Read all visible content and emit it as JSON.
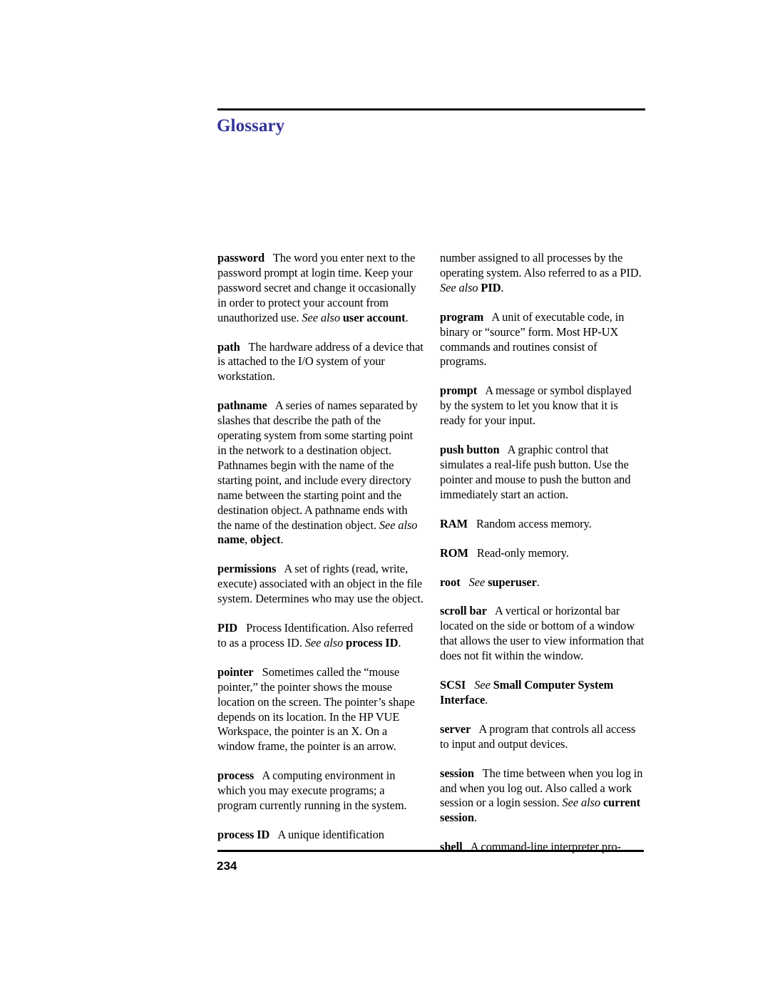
{
  "document": {
    "title": "Glossary",
    "title_color": "#333399",
    "page_number": "234"
  },
  "columns": {
    "left": [
      {
        "term": "password",
        "body_1": "The word you enter next to the password prompt at login time. Keep your password secret and change it occasionally in order to protect your account from unauthorized use. ",
        "see_also": "See also",
        "ref": " user account",
        "tail": "."
      },
      {
        "term": "path",
        "body_1": "The hardware address of a device that is attached to the I/O system of your workstation.",
        "see_also": "",
        "ref": "",
        "tail": ""
      },
      {
        "term": "pathname",
        "body_1": "A series of names separated by slashes that describe the path of the operating system from some starting point in the network to a destination object. Pathnames begin with the name of the starting point, and include every directory name between the starting point and the destination object. A pathname ends with the name of the destination object. ",
        "see_also": "See also",
        "ref": " name",
        "tail": ", ",
        "ref_2": "object",
        "tail_2": "."
      },
      {
        "term": "permissions",
        "body_1": "A set of rights (read, write, execute) associated with an object in the file system. Determines who may use the object.",
        "see_also": "",
        "ref": "",
        "tail": ""
      },
      {
        "term": "PID",
        "body_1": "Process Identification. Also referred to as a process ID. ",
        "see_also": "See also",
        "ref": " process ID",
        "tail": "."
      },
      {
        "term": "pointer",
        "body_1": "Sometimes called the “mouse pointer,” the pointer shows the mouse location on the screen. The pointer’s shape depends on its location. In the HP VUE Workspace, the pointer is an X. On a window frame, the pointer is an arrow.",
        "see_also": "",
        "ref": "",
        "tail": ""
      },
      {
        "term": "process",
        "body_1": "A computing environment in which you may execute programs; a program currently running in the system.",
        "see_also": "",
        "ref": "",
        "tail": ""
      },
      {
        "term": "process ID",
        "body_1": "A unique identification",
        "see_also": "",
        "ref": "",
        "tail": ""
      }
    ],
    "right": [
      {
        "term": "",
        "body_1": "number assigned to all processes by the operating system. Also referred to as a PID. ",
        "see_also": "See also",
        "ref": " PID",
        "tail": "."
      },
      {
        "term": "program",
        "body_1": "A unit of executable code, in binary or “source” form. Most HP-UX commands and routines consist of programs.",
        "see_also": "",
        "ref": "",
        "tail": ""
      },
      {
        "term": "prompt",
        "body_1": "A message or symbol displayed by the system to let you know that it is ready for your input.",
        "see_also": "",
        "ref": "",
        "tail": ""
      },
      {
        "term": "push button",
        "body_1": "A graphic control that simulates a real-life push button. Use the pointer and mouse to push the button and immediately start an action.",
        "see_also": "",
        "ref": "",
        "tail": ""
      },
      {
        "term": "RAM",
        "body_1": "Random access memory.",
        "see_also": "",
        "ref": "",
        "tail": ""
      },
      {
        "term": "ROM",
        "body_1": "Read-only memory.",
        "see_also": "",
        "ref": "",
        "tail": ""
      },
      {
        "term": "root",
        "body_1": "",
        "see_also": "See",
        "ref": " superuser",
        "tail": "."
      },
      {
        "term": "scroll bar",
        "body_1": "A vertical or horizontal bar located on the side or bottom of a window that allows the user to view information that does not fit within the window.",
        "see_also": "",
        "ref": "",
        "tail": ""
      },
      {
        "term": "SCSI",
        "body_1": "",
        "see_also": "See",
        "ref": " Small Computer System Interface",
        "tail": "."
      },
      {
        "term": "server",
        "body_1": "A program that controls all access to input and output devices.",
        "see_also": "",
        "ref": "",
        "tail": ""
      },
      {
        "term": "session",
        "body_1": "The time between when you log in and when you log out. Also called a work session or a login session. ",
        "see_also": "See also",
        "ref": " current session",
        "tail": "."
      },
      {
        "term": "shell",
        "body_1": "A command-line interpreter pro-",
        "see_also": "",
        "ref": "",
        "tail": ""
      }
    ]
  }
}
